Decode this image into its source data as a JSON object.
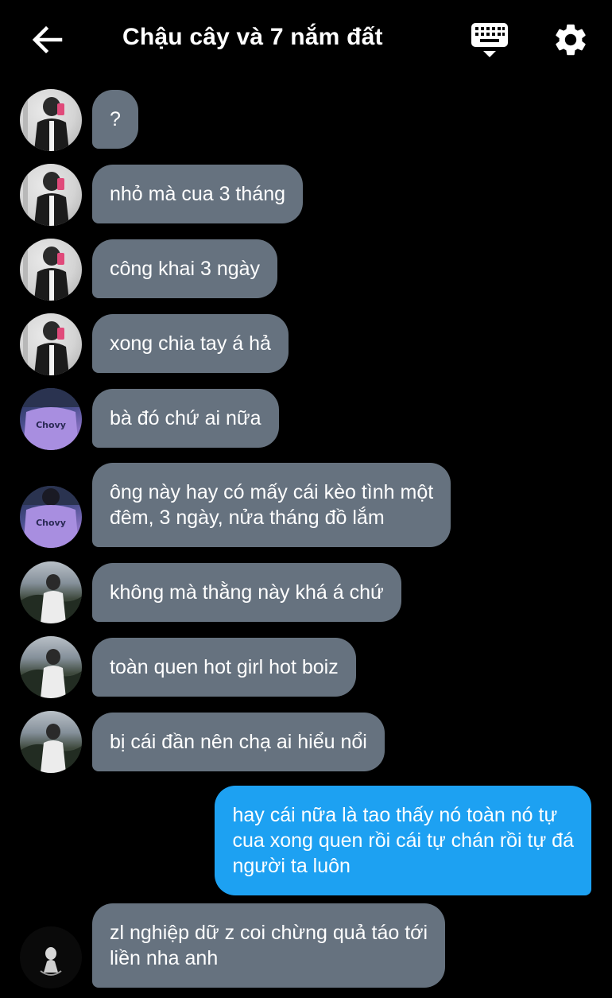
{
  "header": {
    "title": "Chậu cây và 7 nắm đất",
    "back_icon": "arrow-left-icon",
    "keyboard_icon": "keyboard-icon",
    "settings_icon": "gear-icon"
  },
  "colors": {
    "background": "#000000",
    "incoming_bubble": "#66727f",
    "outgoing_bubble": "#1da1f2",
    "text": "#ffffff"
  },
  "messages": [
    {
      "sender": "incoming",
      "avatar": "avatar-person-mirror-selfie",
      "text": "?"
    },
    {
      "sender": "incoming",
      "avatar": "avatar-person-mirror-selfie",
      "text": "nhỏ mà cua 3 tháng"
    },
    {
      "sender": "incoming",
      "avatar": "avatar-person-mirror-selfie",
      "text": "công khai 3 ngày"
    },
    {
      "sender": "incoming",
      "avatar": "avatar-person-mirror-selfie",
      "text": "xong chia tay á hả"
    },
    {
      "sender": "incoming",
      "avatar": "avatar-chovy-jersey",
      "avatar_text": "Chovy",
      "text": "bà đó chứ ai nữa"
    },
    {
      "sender": "incoming",
      "avatar": "avatar-chovy-jersey",
      "avatar_text": "Chovy",
      "text": "ông này hay có mấy cái kèo tình một\nđêm, 3 ngày, nửa tháng đồ lắm"
    },
    {
      "sender": "incoming",
      "avatar": "avatar-person-outdoor",
      "text": "không mà thằng này khá á chứ"
    },
    {
      "sender": "incoming",
      "avatar": "avatar-person-outdoor",
      "text": "toàn quen hot girl hot boiz"
    },
    {
      "sender": "incoming",
      "avatar": "avatar-person-outdoor",
      "text": "bị cái đần nên chạ ai hiểu nổi"
    },
    {
      "sender": "outgoing",
      "text": "hay cái nữa là tao thấy nó toàn nó tự\ncua xong quen rồi cái tự chán rồi tự đá\nngười ta luôn"
    },
    {
      "sender": "incoming",
      "avatar": "avatar-dark-figure",
      "text": "zl nghiệp dữ z coi chừng quả táo tới\nliền nha anh"
    }
  ]
}
